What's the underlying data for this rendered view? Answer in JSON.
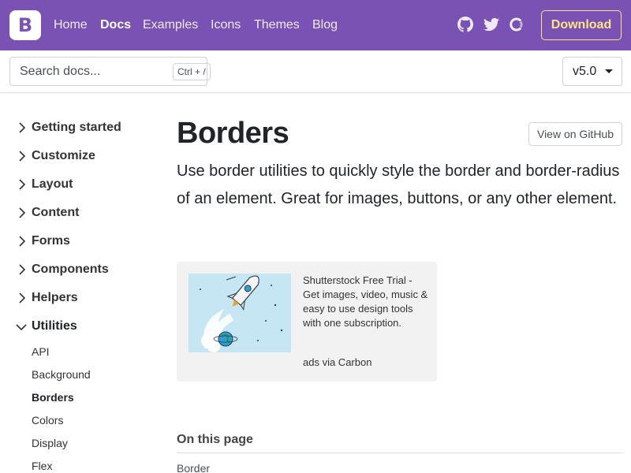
{
  "navbar": {
    "brand_letter": "B",
    "links": [
      "Home",
      "Docs",
      "Examples",
      "Icons",
      "Themes",
      "Blog"
    ],
    "active": "Docs",
    "icons": [
      "github-icon",
      "twitter-icon",
      "opencollective-icon"
    ],
    "download_label": "Download",
    "colors": {
      "background": "#7952b3",
      "download": "#ffe484"
    }
  },
  "subnav": {
    "search_placeholder": "Search docs...",
    "search_shortcut": "Ctrl + /",
    "version": "v5.0"
  },
  "sidebar": {
    "groups": [
      {
        "label": "Getting started",
        "expanded": false
      },
      {
        "label": "Customize",
        "expanded": false
      },
      {
        "label": "Layout",
        "expanded": false
      },
      {
        "label": "Content",
        "expanded": false
      },
      {
        "label": "Forms",
        "expanded": false
      },
      {
        "label": "Components",
        "expanded": false
      },
      {
        "label": "Helpers",
        "expanded": false
      },
      {
        "label": "Utilities",
        "expanded": true
      }
    ],
    "utilities_items": [
      "API",
      "Background",
      "Borders",
      "Colors",
      "Display",
      "Flex"
    ],
    "active_item": "Borders"
  },
  "main": {
    "title": "Borders",
    "github_button": "View on GitHub",
    "lead": "Use border utilities to quickly style the border and border-radius of an element. Great for images, buttons, or any other element.",
    "ad": {
      "text": "Shutterstock Free Trial - Get images, video, music & easy to use design tools with one subscription.",
      "powered_by": "ads via Carbon"
    },
    "toc": {
      "title": "On this page",
      "items": [
        "Border"
      ]
    }
  }
}
